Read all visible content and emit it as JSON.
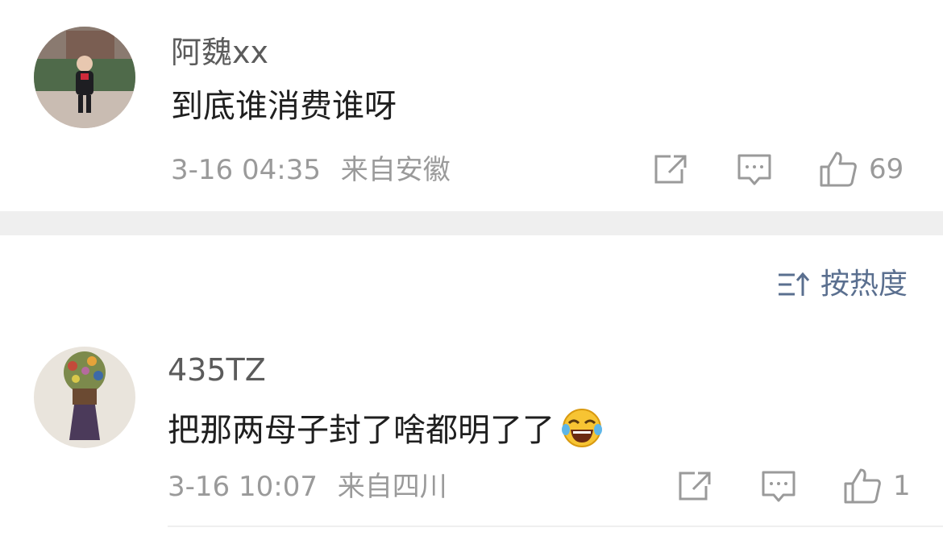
{
  "comments": [
    {
      "username": "阿魏xx",
      "text": "到底谁消费谁呀",
      "date": "3-16 04:35",
      "location": "来自安徽",
      "likes": "69",
      "avatar_icon": "child-photo-avatar"
    },
    {
      "username": "435TZ",
      "text": "把那两母子封了啥都明了了",
      "date": "3-16 10:07",
      "location": "来自四川",
      "likes": "1",
      "emoji_icon": "laughing-tears-emoji",
      "avatar_icon": "flower-bouquet-avatar"
    }
  ],
  "sort": {
    "label": "按热度",
    "icon": "sort-icon"
  },
  "colors": {
    "meta": "#9a9a9a",
    "accent": "#5a6f8f",
    "divider": "#efefef"
  }
}
